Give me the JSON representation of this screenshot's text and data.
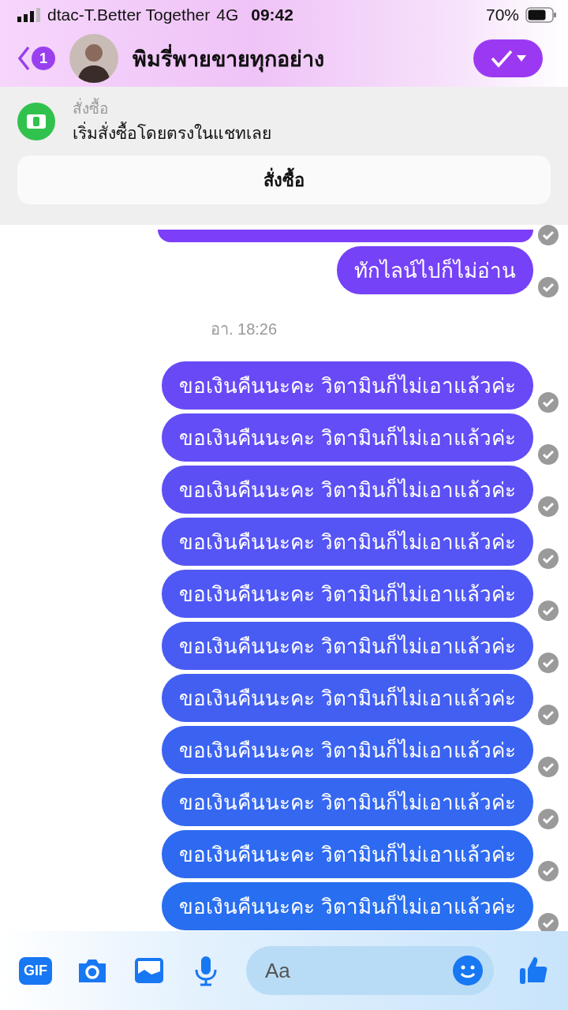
{
  "status_bar": {
    "carrier": "dtac-T.Better Together",
    "network": "4G",
    "time": "09:42",
    "battery": "70%"
  },
  "header": {
    "back_badge": "1",
    "title": "พิมรี่พายขายทุกอย่าง"
  },
  "order_banner": {
    "label": "สั่งซื้อ",
    "text": "เริ่มสั่งซื้อโดยตรงในแชทเลย",
    "button": "สั่งซื้อ"
  },
  "messages": [
    {
      "kind": "cut"
    },
    {
      "kind": "bubble",
      "text": "ทักไลน์ไปก็ไม่อ่าน"
    },
    {
      "kind": "time",
      "text": "อา. 18:26"
    },
    {
      "kind": "bubble",
      "text": "ขอเงินคืนนะคะ วิตามินก็ไม่เอาแล้วค่ะ"
    },
    {
      "kind": "bubble",
      "text": "ขอเงินคืนนะคะ วิตามินก็ไม่เอาแล้วค่ะ"
    },
    {
      "kind": "bubble",
      "text": "ขอเงินคืนนะคะ วิตามินก็ไม่เอาแล้วค่ะ"
    },
    {
      "kind": "bubble",
      "text": "ขอเงินคืนนะคะ วิตามินก็ไม่เอาแล้วค่ะ"
    },
    {
      "kind": "bubble",
      "text": "ขอเงินคืนนะคะ วิตามินก็ไม่เอาแล้วค่ะ"
    },
    {
      "kind": "bubble",
      "text": "ขอเงินคืนนะคะ วิตามินก็ไม่เอาแล้วค่ะ"
    },
    {
      "kind": "bubble",
      "text": "ขอเงินคืนนะคะ วิตามินก็ไม่เอาแล้วค่ะ"
    },
    {
      "kind": "bubble",
      "text": "ขอเงินคืนนะคะ วิตามินก็ไม่เอาแล้วค่ะ"
    },
    {
      "kind": "bubble",
      "text": "ขอเงินคืนนะคะ วิตามินก็ไม่เอาแล้วค่ะ"
    },
    {
      "kind": "bubble",
      "text": "ขอเงินคืนนะคะ วิตามินก็ไม่เอาแล้วค่ะ"
    },
    {
      "kind": "bubble",
      "text": "ขอเงินคืนนะคะ วิตามินก็ไม่เอาแล้วค่ะ"
    }
  ],
  "composer": {
    "gif": "GIF",
    "placeholder": "Aa"
  }
}
